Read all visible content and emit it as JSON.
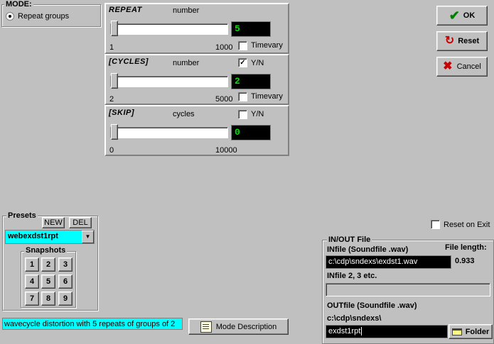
{
  "mode": {
    "title": "MODE:",
    "option": "Repeat groups"
  },
  "params": [
    {
      "name": "REPEAT",
      "unit": "number",
      "value": "5",
      "min": "1",
      "max": "1000",
      "timevary": "Timevary",
      "yn": ""
    },
    {
      "name": "[CYCLES]",
      "unit": "number",
      "value": "2",
      "min": "2",
      "max": "5000",
      "timevary": "Timevary",
      "yn": "Y/N",
      "yn_checked": true
    },
    {
      "name": "[SKIP]",
      "unit": "cycles",
      "value": "0",
      "min": "0",
      "max": "10000",
      "timevary": "",
      "yn": "Y/N",
      "yn_checked": false
    }
  ],
  "actions": {
    "ok": "OK",
    "reset": "Reset",
    "cancel": "Cancel"
  },
  "reset_on_exit": "Reset on Exit",
  "presets": {
    "title": "Presets",
    "new": "NEW",
    "del": "DEL",
    "selected": "webexdst1rpt",
    "snapshots_title": "Snapshots",
    "snapshots": [
      "1",
      "2",
      "3",
      "4",
      "5",
      "6",
      "7",
      "8",
      "9"
    ]
  },
  "description": {
    "text": "wavecycle distortion with 5 repeats of groups of 2",
    "button": "Mode Description"
  },
  "io": {
    "title": "IN/OUT File",
    "infile_label": "INfile (Soundfile .wav)",
    "file_length_label": "File length:",
    "file_length_value": "0.933",
    "infile_value": "c:\\cdp\\sndexs\\exdst1.wav",
    "infile2_label": "INfile 2, 3 etc.",
    "infile2_value": "",
    "outfile_label": "OUTfile (Soundfile .wav)",
    "outfile_dir": "c:\\cdp\\sndexs\\",
    "outfile_value": "exdst1rpt",
    "folder_button": "Folder"
  },
  "colors": {
    "value_text": "#00e000",
    "preset_select_bg": "#00ffff",
    "description_bg": "#00ffff",
    "ok_icon": "#008000",
    "reset_icon": "#cc0000",
    "cancel_icon": "#cc0000"
  }
}
